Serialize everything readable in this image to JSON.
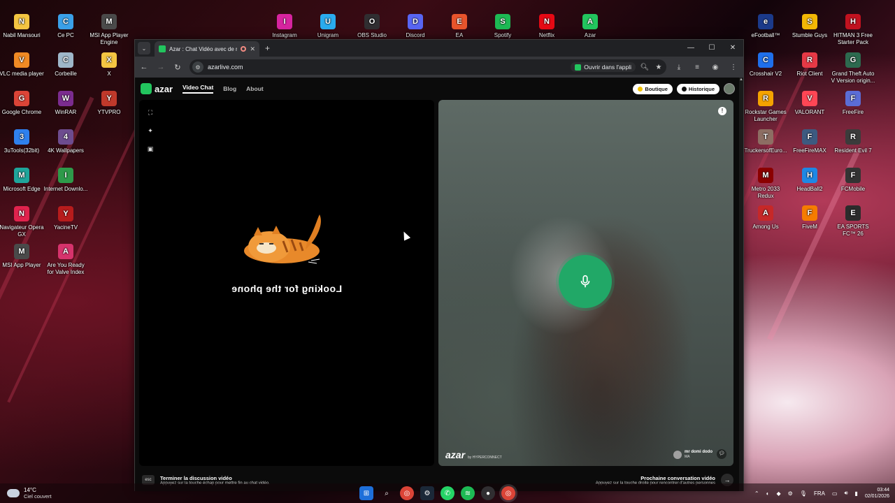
{
  "desktop": {
    "left_icons": [
      {
        "label": "Nabil Mansouri",
        "icon": "folder-icon",
        "color": "#f4c542"
      },
      {
        "label": "Ce PC",
        "icon": "computer-icon",
        "color": "#3aa0e8"
      },
      {
        "label": "MSI App Player Engine",
        "icon": "msi-icon",
        "color": "#4a4a4a"
      },
      {
        "label": "VLC media player",
        "icon": "vlc-icon",
        "color": "#f08a24"
      },
      {
        "label": "Corbeille",
        "icon": "recycle-bin-icon",
        "color": "#9fb7c9"
      },
      {
        "label": "X",
        "icon": "folder-icon",
        "color": "#f4c542"
      },
      {
        "label": "Google Chrome",
        "icon": "chrome-icon",
        "color": "#db4437"
      },
      {
        "label": "WinRAR",
        "icon": "winrar-icon",
        "color": "#7b2c8f"
      },
      {
        "label": "YTVPRO",
        "icon": "ytvpro-icon",
        "color": "#c0392b"
      },
      {
        "label": "3uTools(32bit)",
        "icon": "3utools-icon",
        "color": "#2f80ed"
      },
      {
        "label": "4K Wallpapers",
        "icon": "wallpaper-icon",
        "color": "#6d4c8f"
      },
      {
        "label": "Microsoft Edge",
        "icon": "edge-icon",
        "color": "#1fa59b"
      },
      {
        "label": "Internet Downlo...",
        "icon": "idm-icon",
        "color": "#2e9a4a"
      },
      {
        "label": "Navigateur Opera GX",
        "icon": "opera-gx-icon",
        "color": "#e0234d"
      },
      {
        "label": "YacineTV",
        "icon": "yacinetv-icon",
        "color": "#b71c1c"
      },
      {
        "label": "MSI App Player",
        "icon": "msi-icon",
        "color": "#4a4a4a"
      },
      {
        "label": "Are You Ready for Valve Index",
        "icon": "valve-icon",
        "color": "#d6336c"
      }
    ],
    "top_icons": [
      {
        "label": "Instagram",
        "icon": "instagram-icon",
        "color": "#d6249f"
      },
      {
        "label": "Unigram",
        "icon": "telegram-icon",
        "color": "#2aabee"
      },
      {
        "label": "OBS Studio",
        "icon": "obs-icon",
        "color": "#302e31"
      },
      {
        "label": "Discord",
        "icon": "discord-icon",
        "color": "#5865f2"
      },
      {
        "label": "EA",
        "icon": "ea-icon",
        "color": "#e8542c"
      },
      {
        "label": "Spotify",
        "icon": "spotify-icon",
        "color": "#1db954"
      },
      {
        "label": "Netflix",
        "icon": "netflix-icon",
        "color": "#e50914"
      },
      {
        "label": "Azar",
        "icon": "azar-icon",
        "color": "#22c55e"
      }
    ],
    "right_icons": [
      {
        "label": "eFootball™",
        "icon": "efootball-icon",
        "color": "#1b3a8a"
      },
      {
        "label": "Stumble Guys",
        "icon": "stumble-guys-icon",
        "color": "#f2b705"
      },
      {
        "label": "HITMAN 3 Free Starter Pack",
        "icon": "hitman-icon",
        "color": "#c1121f"
      },
      {
        "label": "Crosshair V2",
        "icon": "crosshair-icon",
        "color": "#1f6feb"
      },
      {
        "label": "Riot Client",
        "icon": "riot-icon",
        "color": "#e63946"
      },
      {
        "label": "Grand Theft Auto V Version origin...",
        "icon": "gta-icon",
        "color": "#2d6a4f"
      },
      {
        "label": "Rockstar Games Launcher",
        "icon": "rockstar-icon",
        "color": "#f4a300"
      },
      {
        "label": "VALORANT",
        "icon": "valorant-icon",
        "color": "#ff4655"
      },
      {
        "label": "FreeFire",
        "icon": "freefire-icon",
        "color": "#5b6dd6"
      },
      {
        "label": "TruckersofEuro...",
        "icon": "truckers-icon",
        "color": "#8d6e63"
      },
      {
        "label": "FreeFireMAX",
        "icon": "freefiremax-icon",
        "color": "#3d5a80"
      },
      {
        "label": "Resident Evil 7",
        "icon": "re7-icon",
        "color": "#3b3b3b"
      },
      {
        "label": "Metro 2033 Redux",
        "icon": "metro-icon",
        "color": "#8b0000"
      },
      {
        "label": "HeadBall2",
        "icon": "headball-icon",
        "color": "#1e88e5"
      },
      {
        "label": "FCMobile",
        "icon": "fcmobile-icon",
        "color": "#333333"
      },
      {
        "label": "Among Us",
        "icon": "among-us-icon",
        "color": "#c62828"
      },
      {
        "label": "FiveM",
        "icon": "fivem-icon",
        "color": "#f57c00"
      },
      {
        "label": "EA SPORTS FC™ 26",
        "icon": "easportsfc-icon",
        "color": "#2b2b2b"
      }
    ]
  },
  "browser": {
    "tab_title": "Azar : Chat Vidéo avec de n",
    "url": "azarlive.com",
    "open_in_app": "Ouvrir dans l'appli"
  },
  "site": {
    "logo": "azar",
    "nav": [
      "Video Chat",
      "Blog",
      "About"
    ],
    "shop_label": "Boutique",
    "history_label": "Historique",
    "left_status": "Looking for the phone",
    "watermark": "azar",
    "watermark_sub": "by HYPERCONNECT",
    "remote_user": "mr domi dodo",
    "remote_country": "MA",
    "end_title": "Terminer la discussion vidéo",
    "end_hint": "Appuyez sur la touche échap pour mettre fin au chat vidéo.",
    "esc_key": "esc",
    "next_title": "Prochaine conversation vidéo",
    "next_hint": "Appuyez sur la touche droite pour rencontrer d'autres personnes"
  },
  "taskbar": {
    "temp": "14°C",
    "weather": "Ciel couvert",
    "lang": "FRA",
    "time": "03:44",
    "date": "02/01/2026"
  },
  "colors": {
    "accent": "#21a867",
    "brand": "#22c55e"
  }
}
